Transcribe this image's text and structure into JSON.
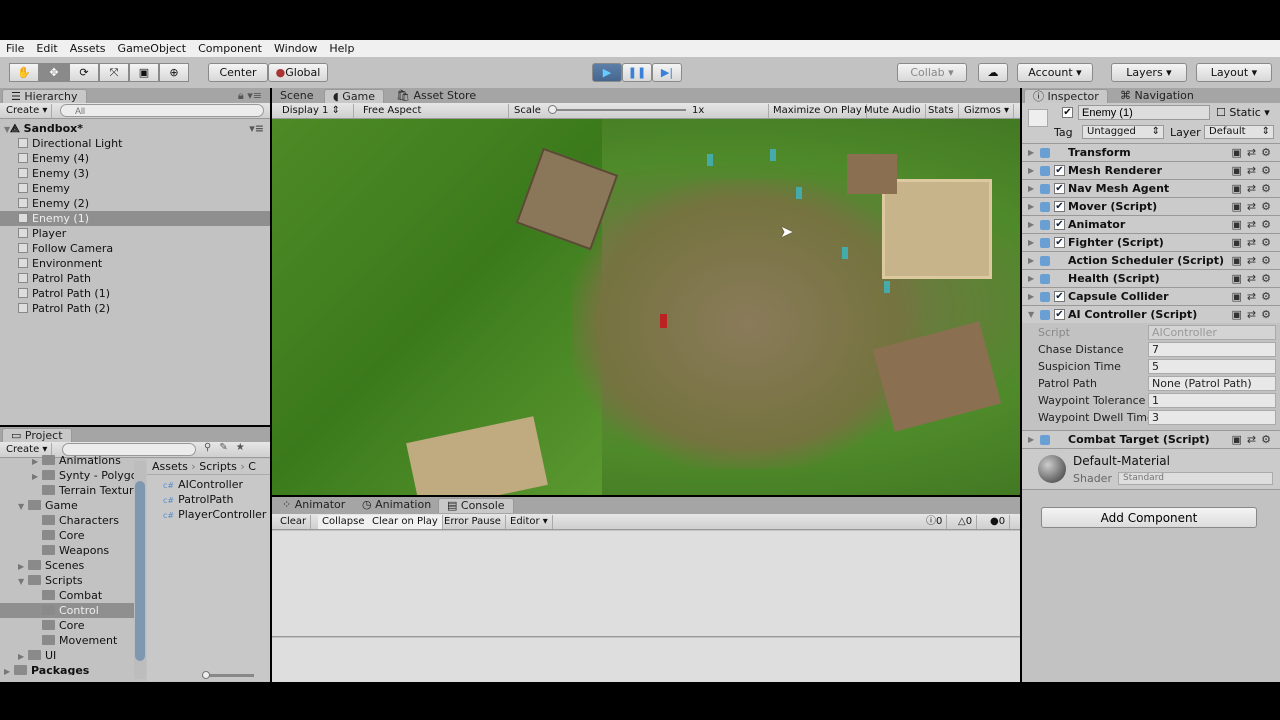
{
  "menu": [
    "File",
    "Edit",
    "Assets",
    "GameObject",
    "Component",
    "Window",
    "Help"
  ],
  "toolbar": {
    "center": "Center",
    "global": "Global",
    "collab": "Collab ▾",
    "account": "Account",
    "layers": "Layers",
    "layout": "Layout",
    "play_active": true
  },
  "hierarchy": {
    "tab": "Hierarchy",
    "create": "Create",
    "search_placeholder": "All",
    "scene": "Sandbox*",
    "items": [
      {
        "label": "Directional Light",
        "exp": false
      },
      {
        "label": "Enemy (4)",
        "exp": true
      },
      {
        "label": "Enemy (3)",
        "exp": true
      },
      {
        "label": "Enemy",
        "exp": true
      },
      {
        "label": "Enemy (2)",
        "exp": true
      },
      {
        "label": "Enemy (1)",
        "exp": true,
        "selected": true
      },
      {
        "label": "Player",
        "exp": true
      },
      {
        "label": "Follow Camera",
        "exp": true
      },
      {
        "label": "Environment",
        "exp": true
      },
      {
        "label": "Patrol Path",
        "exp": true
      },
      {
        "label": "Patrol Path (1)",
        "exp": true
      },
      {
        "label": "Patrol Path (2)",
        "exp": true
      }
    ]
  },
  "game": {
    "tabs": [
      "Scene",
      "Game",
      "Asset Store"
    ],
    "display": "Display 1",
    "aspect": "Free Aspect",
    "scale_label": "Scale",
    "scale_value": "1x",
    "maximize": "Maximize On Play",
    "mute": "Mute Audio",
    "stats": "Stats",
    "gizmos": "Gizmos"
  },
  "console": {
    "tabs": [
      "Animator",
      "Animation",
      "Console"
    ],
    "clear": "Clear",
    "collapse": "Collapse",
    "clear_on_play": "Clear on Play",
    "error_pause": "Error Pause",
    "editor": "Editor",
    "info_count": "0",
    "warn_count": "0",
    "error_count": "0"
  },
  "project": {
    "tab": "Project",
    "create": "Create",
    "tree": [
      {
        "label": "Animations",
        "d": 2,
        "t": "▶"
      },
      {
        "label": "Synty - Polygon",
        "d": 2,
        "t": "▶"
      },
      {
        "label": "Terrain Textures",
        "d": 2,
        "t": ""
      },
      {
        "label": "Game",
        "d": 1,
        "t": "▼"
      },
      {
        "label": "Characters",
        "d": 2,
        "t": ""
      },
      {
        "label": "Core",
        "d": 2,
        "t": ""
      },
      {
        "label": "Weapons",
        "d": 2,
        "t": ""
      },
      {
        "label": "Scenes",
        "d": 1,
        "t": "▶"
      },
      {
        "label": "Scripts",
        "d": 1,
        "t": "▼"
      },
      {
        "label": "Combat",
        "d": 2,
        "t": ""
      },
      {
        "label": "Control",
        "d": 2,
        "t": "",
        "selected": true
      },
      {
        "label": "Core",
        "d": 2,
        "t": ""
      },
      {
        "label": "Movement",
        "d": 2,
        "t": ""
      },
      {
        "label": "UI",
        "d": 1,
        "t": "▶"
      },
      {
        "label": "Packages",
        "d": 0,
        "t": "▶",
        "bold": true
      }
    ],
    "breadcrumb": [
      "Assets",
      "Scripts",
      "C"
    ],
    "files": [
      "AIController",
      "PatrolPath",
      "PlayerController"
    ]
  },
  "inspector": {
    "tabs": [
      "Inspector",
      "Navigation"
    ],
    "object_name": "Enemy (1)",
    "static": "Static",
    "tag_label": "Tag",
    "tag": "Untagged",
    "layer_label": "Layer",
    "layer": "Default",
    "components": [
      {
        "name": "Transform",
        "check": false
      },
      {
        "name": "Mesh Renderer",
        "check": true
      },
      {
        "name": "Nav Mesh Agent",
        "check": true
      },
      {
        "name": "Mover (Script)",
        "check": true
      },
      {
        "name": "Animator",
        "check": true
      },
      {
        "name": "Fighter (Script)",
        "check": true
      },
      {
        "name": "Action Scheduler (Script)",
        "check": false
      },
      {
        "name": "Health (Script)",
        "check": false
      },
      {
        "name": "Capsule Collider",
        "check": true
      },
      {
        "name": "AI Controller (Script)",
        "check": true,
        "expanded": true
      }
    ],
    "ai_props": [
      {
        "label": "Script",
        "value": "AIController"
      },
      {
        "label": "Chase Distance",
        "value": "7"
      },
      {
        "label": "Suspicion Time",
        "value": "5"
      },
      {
        "label": "Patrol Path",
        "value": "None (Patrol Path)"
      },
      {
        "label": "Waypoint Tolerance",
        "value": "1"
      },
      {
        "label": "Waypoint Dwell Time",
        "value": "3"
      }
    ],
    "combat_target": "Combat Target (Script)",
    "material": "Default-Material",
    "shader_label": "Shader",
    "shader": "Standard",
    "add_component": "Add Component"
  }
}
